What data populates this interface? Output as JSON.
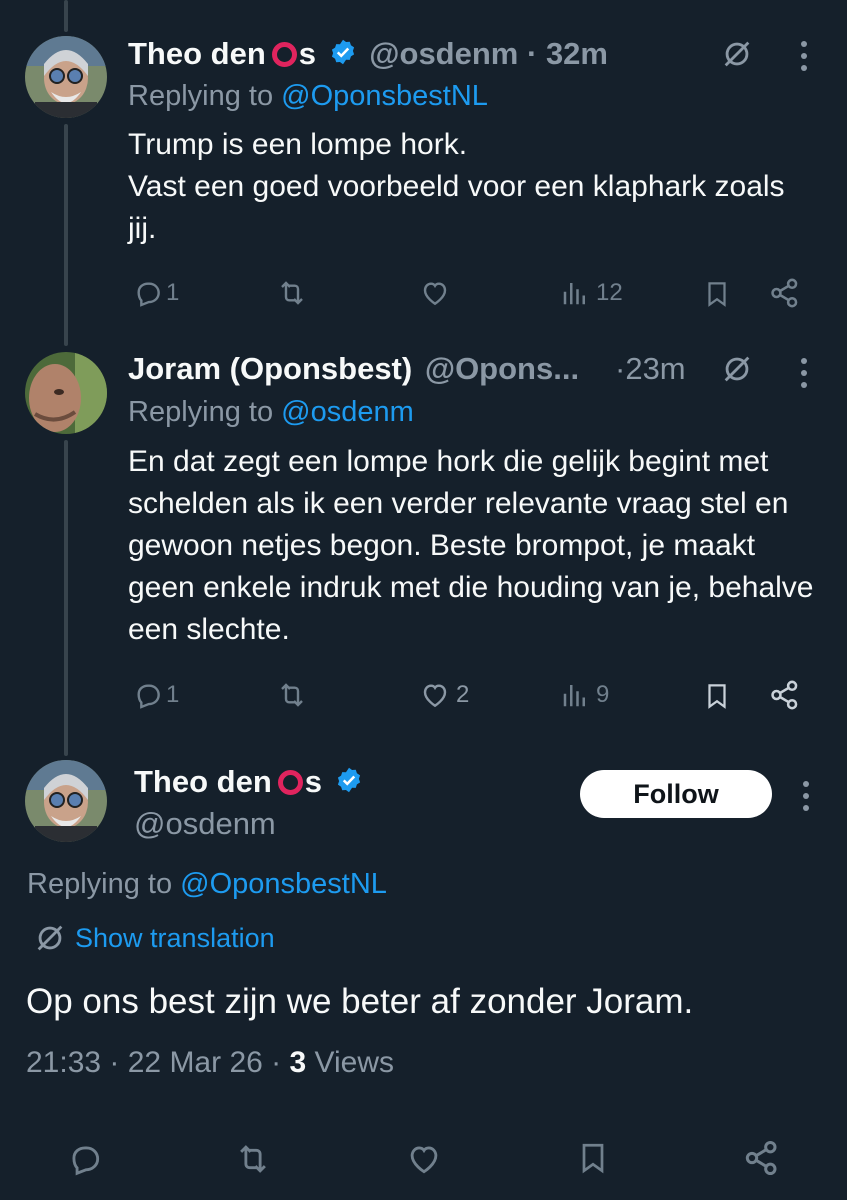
{
  "tweets": [
    {
      "name": "Theo den",
      "name_suffix": "s",
      "handle": "@osdenm",
      "time": "32m",
      "replying_prefix": "Replying to",
      "replying_to": "@OponsbestNL",
      "text": "Trump is een lompe hork.\nVast een goed voorbeeld voor een klaphark zoals jij.",
      "replies": "1",
      "retweets": "",
      "likes": "",
      "views": "12"
    },
    {
      "name": "Joram (Oponsbest)",
      "handle": "@Opons...",
      "time": "23m",
      "replying_prefix": "Replying to",
      "replying_to": "@osdenm",
      "text": "En dat zegt een lompe hork die gelijk begint met schelden als ik een verder relevante vraag stel en gewoon netjes begon. Beste brompot, je maakt geen enkele indruk met die houding van je, behalve een slechte.",
      "replies": "1",
      "retweets": "",
      "likes": "2",
      "views": "9"
    }
  ],
  "main": {
    "name": "Theo den",
    "name_suffix": "s",
    "handle": "@osdenm",
    "follow_label": "Follow",
    "replying_prefix": "Replying to",
    "replying_to": "@OponsbestNL",
    "show_translation": "Show translation",
    "text": "Op ons best zijn we beter af zonder Joram.",
    "timestamp": "21:33 · 22 Mar 26 · ",
    "views_count": "3",
    "views_label": "Views"
  },
  "colors": {
    "background": "#15202b",
    "accent": "#1d9bf0",
    "muted": "#8b98a5",
    "ring": "#e0245e"
  },
  "icons": [
    "verified-badge-icon",
    "translate-icon",
    "more-icon",
    "reply-icon",
    "retweet-icon",
    "like-icon",
    "views-icon",
    "bookmark-icon",
    "share-icon"
  ]
}
